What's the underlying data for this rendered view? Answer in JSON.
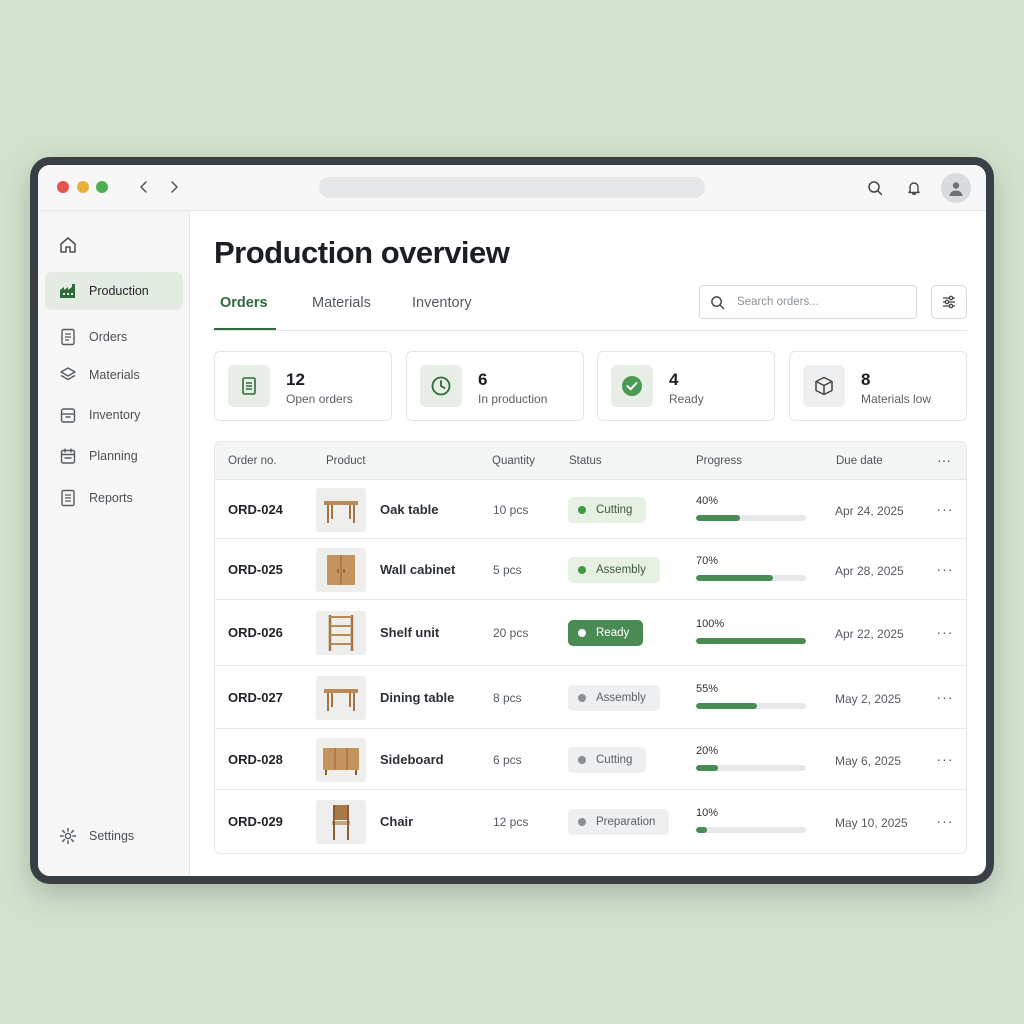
{
  "sidebar": {
    "items": [
      {
        "label": "Production",
        "icon": "factory-icon",
        "active": true
      },
      {
        "label": "Orders",
        "icon": "document-icon"
      },
      {
        "label": "Materials",
        "icon": "layers-icon"
      },
      {
        "label": "Inventory",
        "icon": "archive-icon"
      },
      {
        "label": "Planning",
        "icon": "calendar-icon"
      },
      {
        "label": "Reports",
        "icon": "report-icon"
      }
    ],
    "settings_label": "Settings"
  },
  "main": {
    "title": "Production overview",
    "tabs": [
      {
        "label": "Orders",
        "active": true
      },
      {
        "label": "Materials"
      },
      {
        "label": "Inventory"
      }
    ],
    "search_placeholder": "Search orders..."
  },
  "stats": [
    {
      "value": "12",
      "label": "Open orders",
      "icon": "document-icon"
    },
    {
      "value": "6",
      "label": "In production",
      "icon": "clock-icon"
    },
    {
      "value": "4",
      "label": "Ready",
      "icon": "check-circle-icon"
    },
    {
      "value": "8",
      "label": "Materials low",
      "icon": "box-icon"
    }
  ],
  "table": {
    "headers": {
      "order": "Order no.",
      "product": "Product",
      "quantity": "Quantity",
      "status": "Status",
      "progress": "Progress",
      "due": "Due date",
      "more": "···"
    },
    "rows": [
      {
        "order": "ORD-024",
        "product": "Oak table",
        "thumb": "table",
        "quantity": "10 pcs",
        "status": "Cutting",
        "status_style": "light-green",
        "progress_label": "40%",
        "progress": 0.4,
        "due": "Apr 24, 2025",
        "more": "···"
      },
      {
        "order": "ORD-025",
        "product": "Wall cabinet",
        "thumb": "cabinet",
        "quantity": "5 pcs",
        "status": "Assembly",
        "status_style": "light-green",
        "progress_label": "70%",
        "progress": 0.7,
        "due": "Apr 28, 2025",
        "more": "···"
      },
      {
        "order": "ORD-026",
        "product": "Shelf unit",
        "thumb": "shelf",
        "quantity": "20 pcs",
        "status": "Ready",
        "status_style": "ready",
        "progress_label": "100%",
        "progress": 1.0,
        "due": "Apr 22, 2025",
        "more": "···"
      },
      {
        "order": "ORD-027",
        "product": "Dining table",
        "thumb": "table",
        "quantity": "8 pcs",
        "status": "Assembly",
        "status_style": "grey",
        "progress_label": "55%",
        "progress": 0.55,
        "due": "May 2, 2025",
        "more": "···"
      },
      {
        "order": "ORD-028",
        "product": "Sideboard",
        "thumb": "sideboard",
        "quantity": "6 pcs",
        "status": "Cutting",
        "status_style": "grey",
        "progress_label": "20%",
        "progress": 0.2,
        "due": "May 6, 2025",
        "more": "···"
      },
      {
        "order": "ORD-029",
        "product": "Chair",
        "thumb": "chair",
        "quantity": "12 pcs",
        "status": "Preparation",
        "status_style": "grey",
        "progress_label": "10%",
        "progress": 0.1,
        "due": "May 10, 2025",
        "more": "···"
      }
    ]
  },
  "colors": {
    "accent": "#2f6a3a",
    "progress": "#4a8a53",
    "background": "#d3e2cf"
  }
}
